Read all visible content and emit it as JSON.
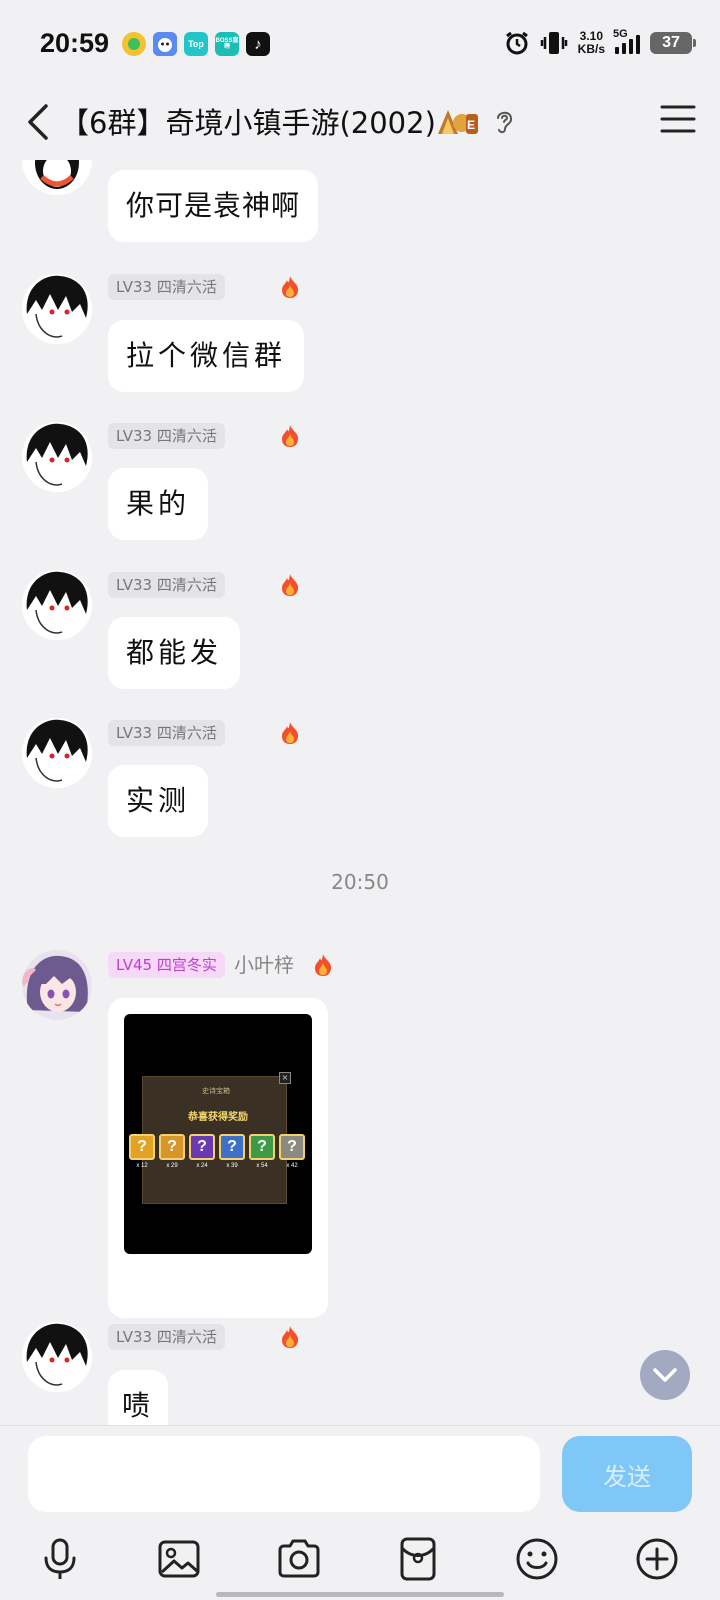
{
  "status_bar": {
    "time": "20:59",
    "apps": [
      {
        "name": "qq-music-icon",
        "label": "",
        "color": "#f2c230"
      },
      {
        "name": "game-app-icon",
        "label": "",
        "color": "#4a7be0"
      },
      {
        "name": "top-app-icon",
        "label": "Top",
        "color": "#22c6c8"
      },
      {
        "name": "boss-app-icon",
        "label": "BOSS直聘",
        "color": "#19bfb3"
      },
      {
        "name": "tiktok-icon",
        "label": "♪",
        "color": "#111111"
      }
    ],
    "net_speed_value": "3.10",
    "net_speed_unit": "KB/s",
    "network_type": "5G",
    "battery": "37"
  },
  "header": {
    "title": "【6群】奇境小镇手游(2002)",
    "badge_icon": "ace-badge-icon",
    "ear_icon": "ear-icon",
    "menu_icon": "menu-icon"
  },
  "messages": {
    "msg1": {
      "text": "你可是袁神啊"
    },
    "msg2": {
      "tag": "LV33 四清六活",
      "text": "拉个微信群"
    },
    "msg3": {
      "tag": "LV33 四清六活",
      "text": "果的"
    },
    "msg4": {
      "tag": "LV33 四清六活",
      "text": "都能发"
    },
    "msg5": {
      "tag": "LV33 四清六活",
      "text": "实测"
    },
    "timestamp": "20:50",
    "msg6": {
      "tag": "LV45 四宫冬实",
      "nickname": "小叶梓",
      "image": {
        "title": "恭喜获得奖励",
        "subtitle": "史诗宝箱",
        "items": [
          {
            "count": "x 12",
            "color": "#e0a324"
          },
          {
            "count": "x 29",
            "color": "#d8962a"
          },
          {
            "count": "x 24",
            "color": "#6a3ab5"
          },
          {
            "count": "x 39",
            "color": "#3f6fc6"
          },
          {
            "count": "x 54",
            "color": "#3f9a45"
          },
          {
            "count": "x 42",
            "color": "#8a8a80"
          }
        ]
      }
    },
    "msg7": {
      "tag": "LV33 四清六活",
      "text": "啧"
    }
  },
  "input": {
    "placeholder": "",
    "send_label": "发送"
  },
  "toolbar": [
    "voice-icon",
    "image-icon",
    "camera-icon",
    "red-packet-icon",
    "emoji-icon",
    "plus-icon"
  ],
  "colors": {
    "background": "#f1f1f4",
    "bubble": "#ffffff",
    "send_button": "#7fc7f6",
    "vip_tag": "#c03dd0"
  }
}
